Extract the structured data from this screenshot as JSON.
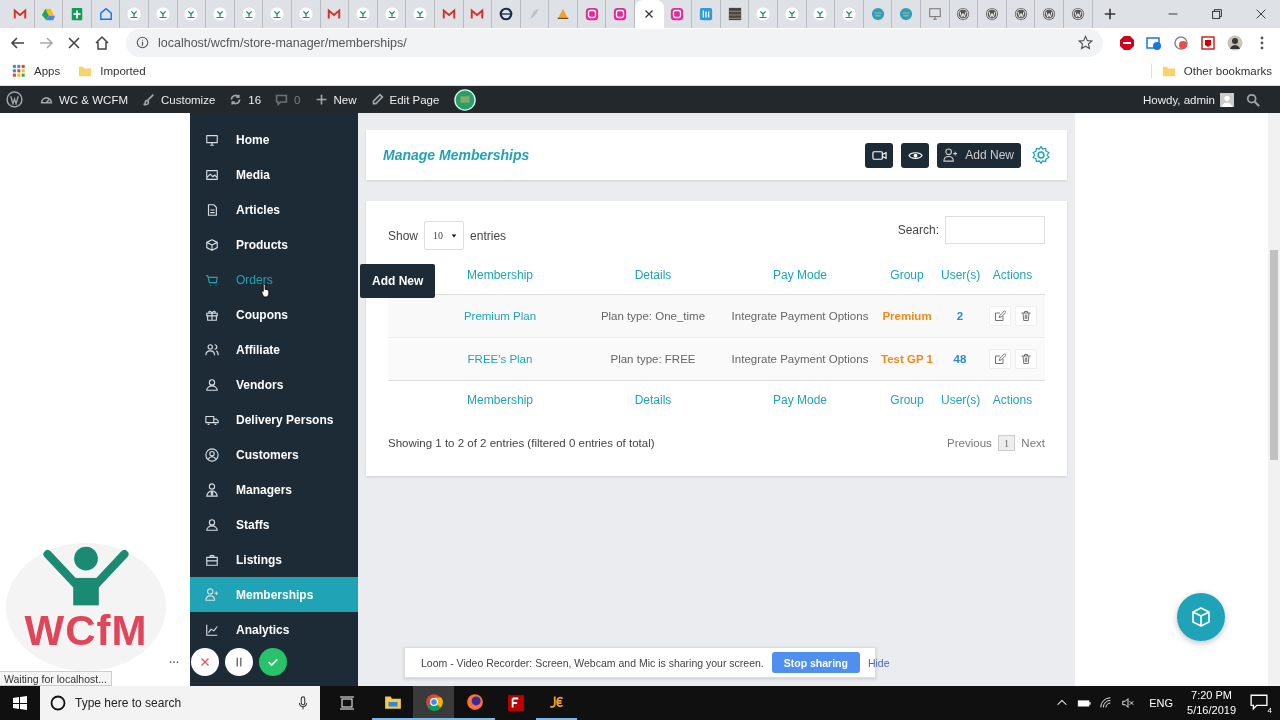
{
  "browser": {
    "tabs": [
      {
        "kind": "mail",
        "selected": false
      },
      {
        "kind": "drive",
        "selected": false
      },
      {
        "kind": "sheets",
        "selected": false
      },
      {
        "kind": "inbox",
        "selected": false
      },
      {
        "kind": "wcfm",
        "selected": false
      },
      {
        "kind": "wcfm",
        "selected": false
      },
      {
        "kind": "wcfm",
        "selected": false
      },
      {
        "kind": "wcfm",
        "selected": false
      },
      {
        "kind": "wcfm",
        "selected": false
      },
      {
        "kind": "wcfm",
        "selected": false
      },
      {
        "kind": "wcfm",
        "selected": false
      },
      {
        "kind": "mail",
        "selected": false
      },
      {
        "kind": "wcfm",
        "selected": false
      },
      {
        "kind": "wcfm",
        "selected": false
      },
      {
        "kind": "wcfm",
        "selected": false
      },
      {
        "kind": "mail",
        "selected": false
      },
      {
        "kind": "mail",
        "selected": false
      },
      {
        "kind": "ring",
        "selected": false
      },
      {
        "kind": "feather",
        "selected": false
      },
      {
        "kind": "sail",
        "selected": false
      },
      {
        "kind": "wamp",
        "selected": false
      },
      {
        "kind": "wamp",
        "selected": false
      },
      {
        "kind": "blank",
        "selected": true
      },
      {
        "kind": "wamp",
        "selected": false
      },
      {
        "kind": "square",
        "selected": false
      },
      {
        "kind": "texture",
        "selected": false
      },
      {
        "kind": "wcfm",
        "selected": false
      },
      {
        "kind": "wcfm",
        "selected": false
      },
      {
        "kind": "wcfm",
        "selected": false
      },
      {
        "kind": "wcfm",
        "selected": false
      },
      {
        "kind": "globe",
        "selected": false
      },
      {
        "kind": "globe",
        "selected": false
      },
      {
        "kind": "monitor",
        "selected": false
      },
      {
        "kind": "wp",
        "selected": false
      },
      {
        "kind": "wp",
        "selected": false
      },
      {
        "kind": "wp",
        "selected": false
      },
      {
        "kind": "wp",
        "selected": false
      },
      {
        "kind": "wp",
        "selected": false
      }
    ],
    "url": "localhost/wcfm/store-manager/memberships/",
    "bookmarks": [
      "Apps",
      "Imported"
    ],
    "other_bookmarks": "Other bookmarks",
    "status": "Waiting for localhost..."
  },
  "admin_bar": {
    "items": [
      {
        "label": "WC & WCFM",
        "disabled": false
      },
      {
        "label": "Customize",
        "disabled": false
      },
      {
        "label": "16",
        "disabled": false
      },
      {
        "label": "0",
        "disabled": true
      },
      {
        "label": "New",
        "disabled": false
      },
      {
        "label": "Edit Page",
        "disabled": false
      }
    ],
    "greeting": "Howdy, admin"
  },
  "sidebar": {
    "items": [
      {
        "label": "Home",
        "selected": false,
        "hovered": false
      },
      {
        "label": "Media",
        "selected": false,
        "hovered": false
      },
      {
        "label": "Articles",
        "selected": false,
        "hovered": false
      },
      {
        "label": "Products",
        "selected": false,
        "hovered": false
      },
      {
        "label": "Orders",
        "selected": false,
        "hovered": true
      },
      {
        "label": "Coupons",
        "selected": false,
        "hovered": false
      },
      {
        "label": "Affiliate",
        "selected": false,
        "hovered": false
      },
      {
        "label": "Vendors",
        "selected": false,
        "hovered": false
      },
      {
        "label": "Delivery Persons",
        "selected": false,
        "hovered": false
      },
      {
        "label": "Customers",
        "selected": false,
        "hovered": false
      },
      {
        "label": "Managers",
        "selected": false,
        "hovered": false
      },
      {
        "label": "Staffs",
        "selected": false,
        "hovered": false
      },
      {
        "label": "Listings",
        "selected": false,
        "hovered": false
      },
      {
        "label": "Memberships",
        "selected": true,
        "hovered": false
      },
      {
        "label": "Analytics",
        "selected": false,
        "hovered": false
      }
    ]
  },
  "tooltip": "Add New",
  "header": {
    "title": "Manage Memberships",
    "add_button": "Add New"
  },
  "table": {
    "show_label": "Show",
    "page_size": "10",
    "entries_label": "entries",
    "search_label": "Search:",
    "columns": [
      "Membership",
      "Details",
      "Pay Mode",
      "Group",
      "User(s)",
      "Actions"
    ],
    "rows": [
      {
        "membership": "Premium Plan",
        "details": "Plan type: One_time",
        "pay_mode": "Integrate Payment Options",
        "group": "Premium",
        "users": "2"
      },
      {
        "membership": "FREE's Plan",
        "details": "Plan type: FREE",
        "pay_mode": "Integrate Payment Options",
        "group": "Test GP 1",
        "users": "48"
      }
    ],
    "footer_columns": [
      "Membership",
      "Details",
      "Pay Mode",
      "Group",
      "User(s)",
      "Actions"
    ],
    "info": "Showing 1 to 2 of 2 entries (filtered 0 entries of total)",
    "previous": "Previous",
    "pages": [
      {
        "label": "1",
        "selected": true
      }
    ],
    "next": "Next"
  },
  "logo": "WCfM",
  "loom": {
    "message": "Loom - Video Recorder: Screen, Webcam and Mic is sharing your screen.",
    "stop": "Stop sharing",
    "hide": "Hide"
  },
  "taskbar": {
    "search_placeholder": "Type here to search",
    "language": "ENG",
    "time": "7:20 PM",
    "date": "5/16/2019",
    "notifications": "4"
  }
}
